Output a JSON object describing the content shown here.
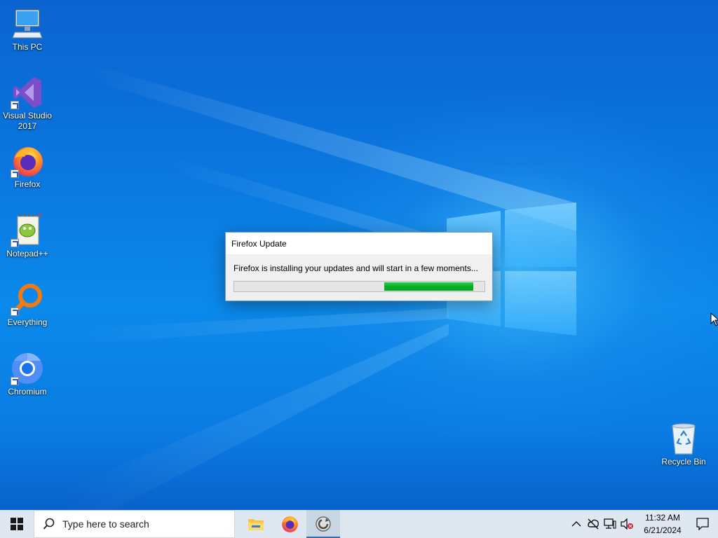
{
  "desktop": {
    "icons": [
      {
        "label": "This PC",
        "icon": "computer-icon",
        "shortcut": false
      },
      {
        "label": "Visual Studio\n2017",
        "icon": "visual-studio-icon",
        "shortcut": true
      },
      {
        "label": "Firefox",
        "icon": "firefox-icon",
        "shortcut": true
      },
      {
        "label": "Notepad++",
        "icon": "notepadpp-icon",
        "shortcut": true
      },
      {
        "label": "Everything",
        "icon": "everything-search-icon",
        "shortcut": true
      },
      {
        "label": "Chromium",
        "icon": "chromium-icon",
        "shortcut": true
      }
    ],
    "recycle_bin": {
      "label": "Recycle Bin",
      "icon": "recycle-bin-icon"
    }
  },
  "dialog": {
    "title": "Firefox Update",
    "message": "Firefox is installing your updates and will start in a few moments...",
    "progress": {
      "fill_start": 0.6,
      "fill_end": 0.955,
      "color": "#06b025",
      "type": "marquee"
    }
  },
  "taskbar": {
    "search_placeholder": "Type here to search",
    "pinned": [
      {
        "name": "file-explorer",
        "icon": "folder-icon",
        "state": "none"
      },
      {
        "name": "firefox",
        "icon": "firefox-icon",
        "state": "none"
      },
      {
        "name": "firefox-updater",
        "icon": "updater-icon",
        "state": "active"
      }
    ],
    "tray": {
      "time": "11:32 AM",
      "date": "6/21/2024",
      "icons": [
        "chevron-up-icon",
        "network-offline-icon",
        "monitor-icon",
        "volume-muted-icon"
      ]
    }
  },
  "colors": {
    "wallpaper": "#0a78e0",
    "taskbar": "#dfe7f0",
    "progress": "#06b025"
  }
}
